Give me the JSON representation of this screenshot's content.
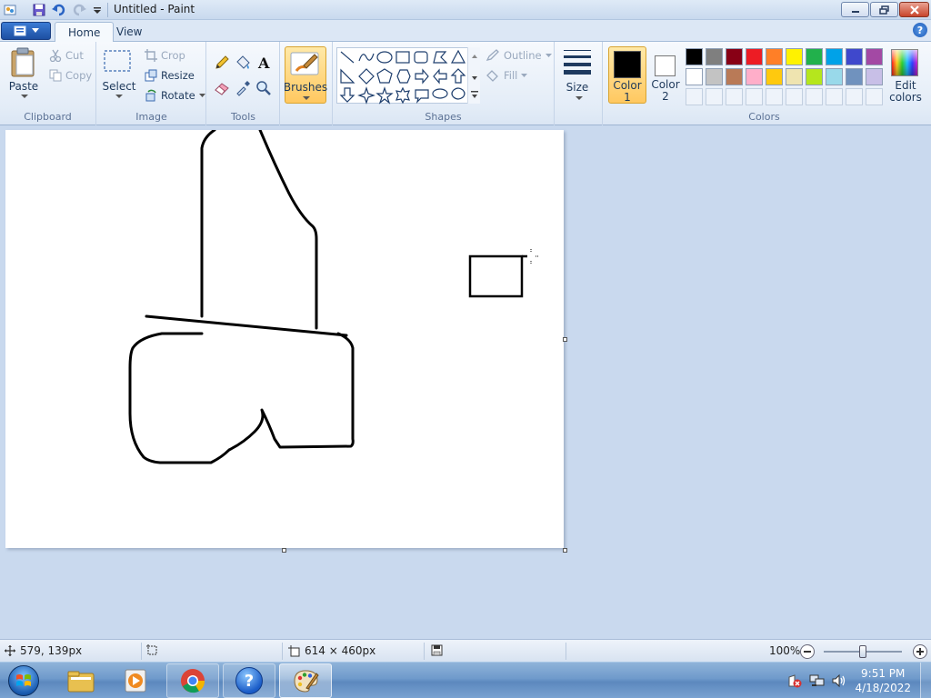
{
  "window": {
    "title": "Untitled - Paint"
  },
  "tabs": {
    "file_label": "",
    "home": "Home",
    "view": "View"
  },
  "ribbon": {
    "clipboard": {
      "label": "Clipboard",
      "paste": "Paste",
      "cut": "Cut",
      "copy": "Copy"
    },
    "image": {
      "label": "Image",
      "select": "Select",
      "crop": "Crop",
      "resize": "Resize",
      "rotate": "Rotate"
    },
    "tools": {
      "label": "Tools"
    },
    "brushes": {
      "label": "Brushes"
    },
    "shapes": {
      "label": "Shapes",
      "outline": "Outline",
      "fill": "Fill"
    },
    "size": {
      "label": "Size"
    },
    "color1": {
      "line1": "Color",
      "line2": "1",
      "value": "#000000"
    },
    "color2": {
      "line1": "Color",
      "line2": "2",
      "value": "#ffffff"
    },
    "colors": {
      "label": "Colors",
      "edit_line1": "Edit",
      "edit_line2": "colors",
      "palette_row1": [
        "#000000",
        "#7f7f7f",
        "#880015",
        "#ed1c24",
        "#ff7f27",
        "#fff200",
        "#22b14c",
        "#00a2e8",
        "#3f48cc",
        "#a349a4"
      ],
      "palette_row2": [
        "#ffffff",
        "#c3c3c3",
        "#b97a57",
        "#ffaec9",
        "#ffc90e",
        "#efe4b0",
        "#b5e61d",
        "#99d9ea",
        "#7092be",
        "#c8bfe7"
      ]
    }
  },
  "status": {
    "cursor_pos": "579, 139px",
    "canvas_size": "614 × 460px",
    "zoom": "100%",
    "zoom_fraction": 0.5
  },
  "taskbar": {
    "clock_time": "9:51 PM",
    "clock_date": "4/18/2022"
  }
}
